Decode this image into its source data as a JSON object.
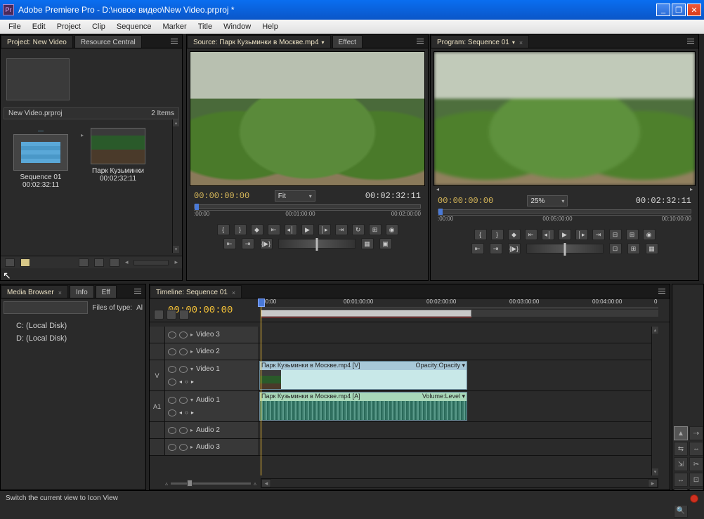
{
  "title": "Adobe Premiere Pro - D:\\новое видео\\New Video.prproj *",
  "menus": [
    "File",
    "Edit",
    "Project",
    "Clip",
    "Sequence",
    "Marker",
    "Title",
    "Window",
    "Help"
  ],
  "project": {
    "tab_label": "Project: New Video",
    "tab2_label": "Resource Central",
    "file_name": "New Video.prproj",
    "item_count": "2 Items",
    "items": [
      {
        "name": "Sequence 01",
        "duration": "00:02:32:11"
      },
      {
        "name": "Парк Кузьминки",
        "duration": "00:02:32:11"
      }
    ]
  },
  "source": {
    "tab_label": "Source: Парк Кузьминки в Москве.mp4",
    "effect_tab": "Effect ",
    "tc_in": "00:00:00:00",
    "tc_out": "00:02:32:11",
    "fit": "Fit",
    "ruler": [
      ":00:00",
      "00:01:00:00",
      "00:02:00:00"
    ]
  },
  "program": {
    "tab_label": "Program: Sequence 01",
    "tc_in": "00:00:00:00",
    "tc_out": "00:02:32:11",
    "zoom": "25%",
    "ruler": [
      ":00:00",
      "00:05:00:00",
      "00:10:00:00"
    ]
  },
  "mediabrowser": {
    "tab1": "Media Browser",
    "tab2": "Info",
    "tab3": "Eff",
    "files_label": "Files of type:",
    "files_value": "Al",
    "drives": [
      "C: (Local Disk)",
      "D: (Local Disk)"
    ]
  },
  "timeline": {
    "tab_label": "Timeline: Sequence 01",
    "playhead_tc": "00:00:00:00",
    "ruler": [
      ":00:00",
      "00:01:00:00",
      "00:02:00:00",
      "00:03:00:00",
      "00:04:00:00",
      "0"
    ],
    "tracks": {
      "v3": "Video 3",
      "v2": "Video 2",
      "v1": "Video 1",
      "a1": "Audio 1",
      "a2": "Audio 2",
      "a3": "Audio 3"
    },
    "track_v": "V",
    "track_a": "A1",
    "video_clip_name": "Парк Кузьминки в Москве.mp4 [V]",
    "video_clip_prop": "Opacity:Opacity ▾",
    "audio_clip_name": "Парк Кузьминки в Москве.mp4 [A]",
    "audio_clip_prop": "Volume:Level ▾"
  },
  "status": "Switch the current view to Icon View"
}
